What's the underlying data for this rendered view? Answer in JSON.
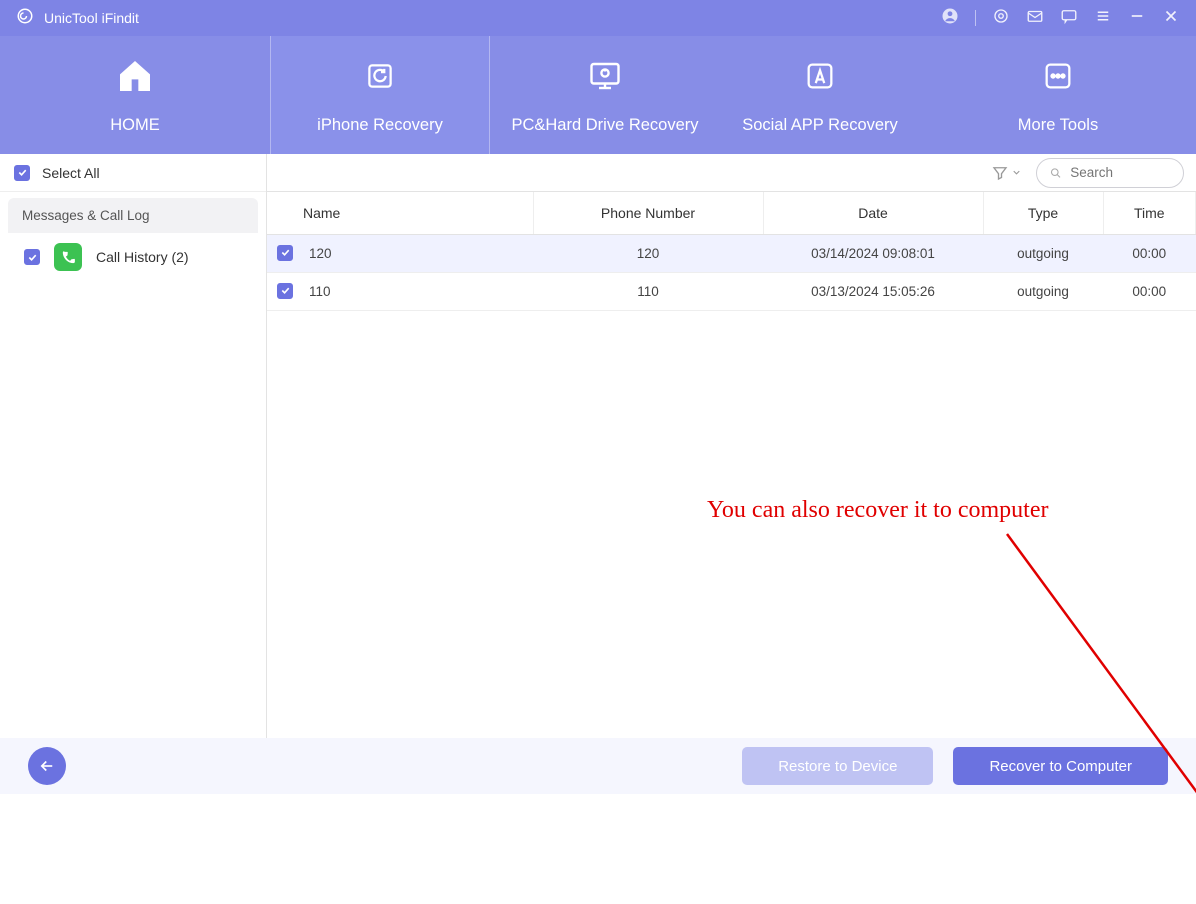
{
  "app": {
    "title": "UnicTool iFindit"
  },
  "nav": {
    "tabs": [
      {
        "label": "HOME"
      },
      {
        "label": "iPhone Recovery"
      },
      {
        "label": "PC&Hard Drive Recovery"
      },
      {
        "label": "Social APP Recovery"
      },
      {
        "label": "More Tools"
      }
    ]
  },
  "sidebar": {
    "select_all_label": "Select All",
    "category_header": "Messages & Call Log",
    "items": [
      {
        "label": "Call History (2)"
      }
    ]
  },
  "toolbar": {
    "search_placeholder": "Search"
  },
  "table": {
    "headers": {
      "name": "Name",
      "phone": "Phone Number",
      "date": "Date",
      "type": "Type",
      "time": "Time"
    },
    "rows": [
      {
        "name": "120",
        "phone": "120",
        "date": "03/14/2024 09:08:01",
        "type": "outgoing",
        "time": "00:00"
      },
      {
        "name": "110",
        "phone": "110",
        "date": "03/13/2024 15:05:26",
        "type": "outgoing",
        "time": "00:00"
      }
    ]
  },
  "footer": {
    "restore_label": "Restore to Device",
    "recover_label": "Recover to Computer"
  },
  "annotation": {
    "text": "You can also recover it to computer"
  }
}
